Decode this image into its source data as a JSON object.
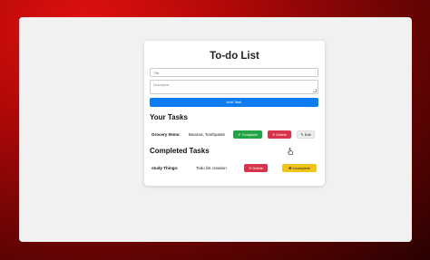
{
  "app": {
    "title": "To-do List"
  },
  "form": {
    "title_placeholder": "Title",
    "description_placeholder": "Description",
    "add_button": "Add Task"
  },
  "sections": {
    "your_tasks": "Your Tasks",
    "completed_tasks": "Completed Tasks"
  },
  "tasks": [
    {
      "title": "Grocery Items:",
      "description": "Banana, Toothpaste",
      "complete_label": "Complete",
      "delete_label": "Delete",
      "edit_label": "Edit"
    }
  ],
  "completed": [
    {
      "title": "study Things:",
      "description": "Todo list creation",
      "delete_label": "Delete",
      "incomplete_label": "Incomplete"
    }
  ],
  "icons": {
    "complete": "check-icon",
    "delete": "close-icon",
    "edit": "pencil-icon",
    "incomplete": "x-mark-icon"
  },
  "colors": {
    "primary": "#0d7cf2",
    "complete": "#22a447",
    "delete": "#d8334a",
    "incomplete": "#f0c419"
  }
}
